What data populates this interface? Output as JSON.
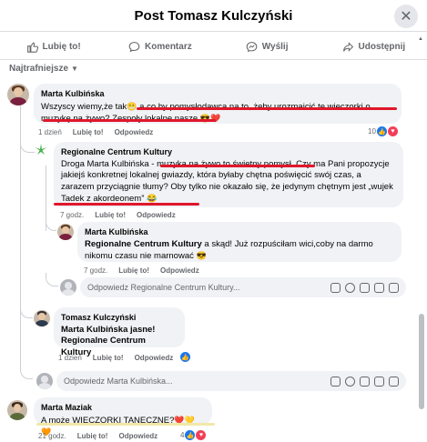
{
  "header": {
    "title": "Post Tomasz Kulczyński"
  },
  "actions": [
    {
      "label": "Lubię to!",
      "icon": "thumbs-up-icon"
    },
    {
      "label": "Komentarz",
      "icon": "comment-icon"
    },
    {
      "label": "Wyślij",
      "icon": "share-arrow-icon"
    },
    {
      "label": "Udostępnij",
      "icon": "share-icon"
    }
  ],
  "sort": {
    "label": "Najtrafniejsze"
  },
  "comments": [
    {
      "author": "Marta Kulbińska",
      "text_a": "Wszyscy wiemy,że tak",
      "emoji_a": "😬",
      "text_b": " a co by pomysłodawca na to, żeby urozmaicić te wieczorki o muzykę na żywo? Zespoły lokalne nasze ",
      "emoji_b": "😎❤️",
      "time": "1 dzień",
      "like": "Lubię to!",
      "reply": "Odpowiedz",
      "reactions_count": "10"
    },
    {
      "author": "Regionalne Centrum Kultury",
      "text": "Droga Marta Kulbińska - muzyka na żywo to świetny pomysł. Czy ma Pani propozycje jakiejś konkretnej lokalnej gwiazdy, która byłaby chętna poświęcić swój czas, a zarazem przyciągnie tłumy? Oby tylko nie okazało się, że jedynym chętnym jest „wujek Tadek z akordeonem”",
      "emoji": "😂",
      "time": "7 godz.",
      "like": "Lubię to!",
      "reply": "Odpowiedz"
    },
    {
      "author": "Marta Kulbińska",
      "mention": "Regionalne Centrum Kultury",
      "text": " a skąd! Już rozpuściłam wici,coby na darmo nikomu czasu nie marnować",
      "emoji": "😎",
      "time": "7 godz.",
      "like": "Lubię to!",
      "reply": "Odpowiedz"
    },
    {
      "reply_placeholder": "Odpowiedz Regionalne Centrum Kultury..."
    },
    {
      "author": "Tomasz Kulczyński",
      "line1": "Marta Kulbińska jasne!",
      "line2": "Regionalne Centrum Kultury",
      "time": "1 dzień",
      "like": "Lubię to!",
      "reply": "Odpowiedz"
    },
    {
      "reply_placeholder": "Odpowiedz Marta Kulbińska..."
    },
    {
      "author": "Marta Maziak",
      "text": "A może WIECZORKI TANECZNE?",
      "emoji": "❤️💛🧡",
      "time": "21 godz.",
      "like": "Lubię to!",
      "reply": "Odpowiedz",
      "reactions_count": "4"
    }
  ],
  "colors": {
    "accent": "#1877f2",
    "highlight_red": "#e0172b",
    "highlight_yellow": "#f2e8a8",
    "bubble": "#f0f2f5"
  }
}
